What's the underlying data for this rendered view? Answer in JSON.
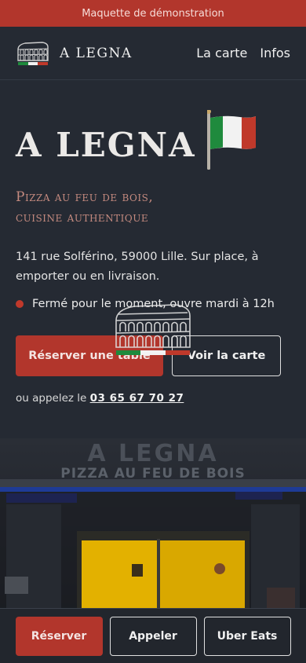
{
  "demo_banner": "Maquette de démonstration",
  "nav": {
    "brand": "A LEGNA",
    "links": [
      "La carte",
      "Infos"
    ]
  },
  "hero": {
    "title": "A LEGNA",
    "tagline_line1": "Pizza au feu de bois,",
    "tagline_line2": "cuisine authentique",
    "address": "141 rue Solférino, 59000 Lille. Sur place, à emporter ou en livraison.",
    "status": "Fermé pour le moment, ouvre mardi à 12h",
    "primary_cta": "Réserver une table",
    "secondary_cta": "Voir la carte",
    "call_prefix": "ou appelez le",
    "phone": "03 65 67 70 27"
  },
  "storefront": {
    "sign_title": "A LEGNA",
    "sign_subtitle": "PIZZA AU FEU DE BOIS"
  },
  "bottom_bar": {
    "reserve": "Réserver",
    "call": "Appeler",
    "uber": "Uber Eats"
  },
  "colors": {
    "background": "#252a33",
    "accent": "#b2362c",
    "tagline": "#c48a7f",
    "status_dot": "#c0392b",
    "flag_green": "#1f8a3d",
    "flag_white": "#f2f2f2",
    "flag_red": "#c0392b"
  },
  "icons": {
    "logo": "colosseum-icon",
    "flag": "italy-flag-icon",
    "status": "status-dot-icon",
    "loader": "colosseum-loader-icon"
  }
}
